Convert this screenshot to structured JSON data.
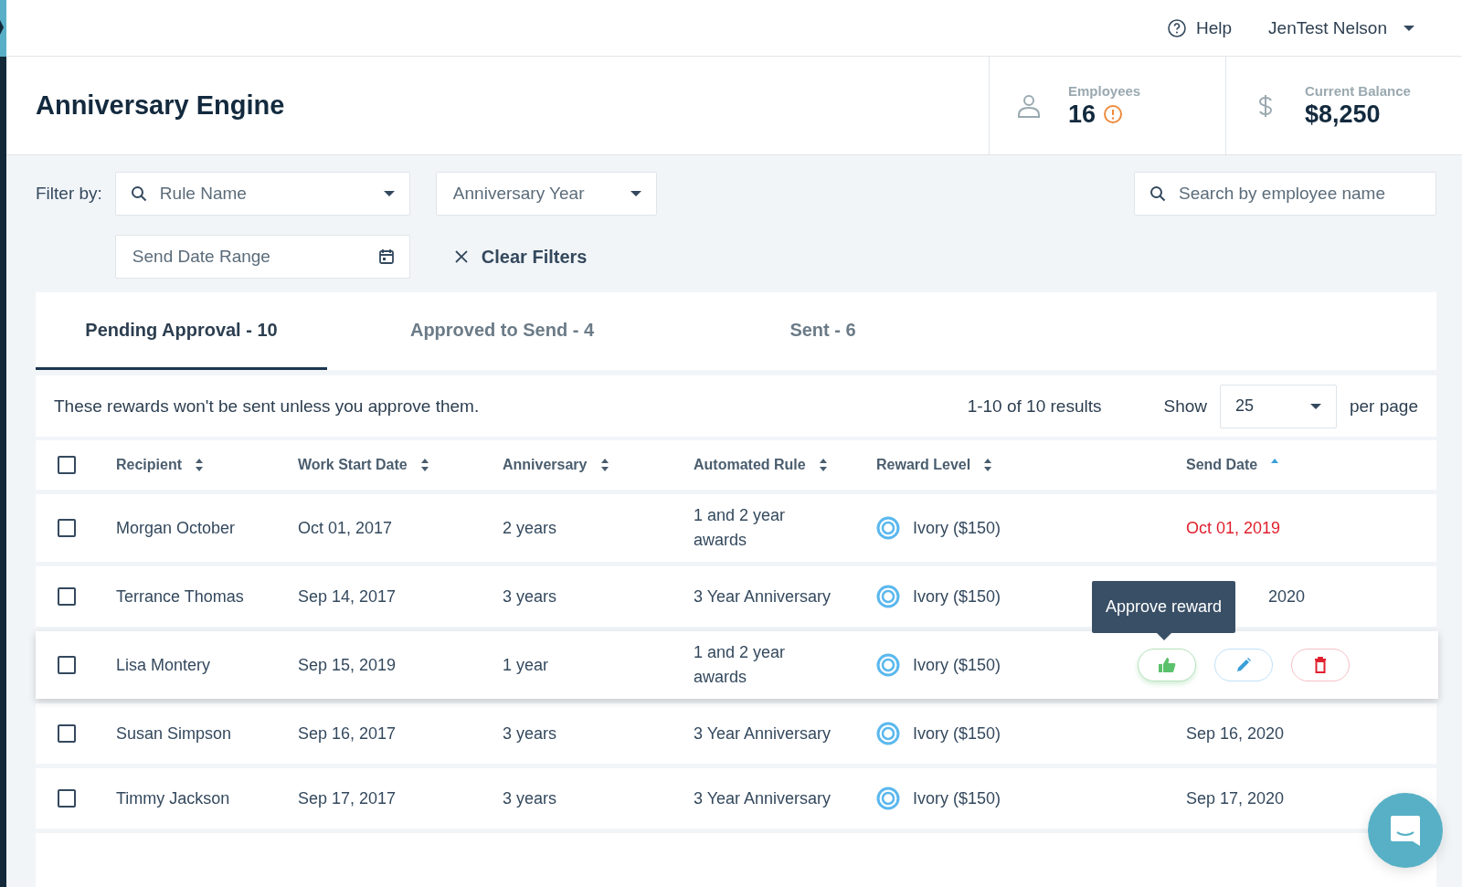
{
  "topbar": {
    "help": "Help",
    "user": "JenTest Nelson"
  },
  "header": {
    "title": "Anniversary Engine",
    "stats": [
      {
        "kind": "employees",
        "label": "Employees",
        "value": "16",
        "warning": true
      },
      {
        "kind": "balance",
        "label": "Current Balance",
        "value": "$8,250"
      }
    ]
  },
  "filters": {
    "label": "Filter by:",
    "rule_name": {
      "placeholder": "Rule Name"
    },
    "anniversary_year": {
      "placeholder": "Anniversary Year"
    },
    "send_date_range": {
      "placeholder": "Send Date Range"
    },
    "clear": "Clear Filters",
    "search": {
      "placeholder": "Search by employee name"
    }
  },
  "tabs": [
    {
      "label": "Pending Approval - 10",
      "selected": true
    },
    {
      "label": "Approved to Send - 4",
      "selected": false
    },
    {
      "label": "Sent - 6",
      "selected": false
    }
  ],
  "toolbar": {
    "note": "These rewards won't be sent unless you approve them.",
    "results": "1-10 of 10 results",
    "show": "Show",
    "page_size": "25",
    "per_page": "per page"
  },
  "table": {
    "select_all": {
      "checked": false
    },
    "columns": [
      {
        "label": "Recipient",
        "sorted": false
      },
      {
        "label": "Work Start Date",
        "sorted": false
      },
      {
        "label": "Anniversary",
        "sorted": false
      },
      {
        "label": "Automated Rule",
        "sorted": false
      },
      {
        "label": "Reward Level",
        "sorted": false
      },
      {
        "label": "Send Date",
        "sorted": true
      }
    ],
    "rows": [
      {
        "checked": false,
        "recipient": "Morgan October",
        "start": "Oct 01, 2017",
        "anniversary": "2 years",
        "rule": "1 and 2 year awards",
        "reward": "Ivory ($150)",
        "send_date": "Oct 01, 2019",
        "overdue": true,
        "hovered": false
      },
      {
        "checked": false,
        "recipient": "Terrance Thomas",
        "start": "Sep 14, 2017",
        "anniversary": "3 years",
        "rule": "3 Year Anniversary",
        "reward": "Ivory ($150)",
        "send_date": "2020",
        "overdue": false,
        "hovered": false
      },
      {
        "checked": false,
        "recipient": "Lisa Montery",
        "start": "Sep 15, 2019",
        "anniversary": "1 year",
        "rule": "1 and 2 year awards",
        "reward": "Ivory ($150)",
        "hovered": true,
        "tooltip": "Approve reward"
      },
      {
        "checked": false,
        "recipient": "Susan Simpson",
        "start": "Sep 16, 2017",
        "anniversary": "3 years",
        "rule": "3 Year Anniversary",
        "reward": "Ivory ($150)",
        "send_date": "Sep 16, 2020",
        "overdue": false,
        "hovered": false
      },
      {
        "checked": false,
        "recipient": "Timmy Jackson",
        "start": "Sep 17, 2017",
        "anniversary": "3 years",
        "rule": "3 Year Anniversary",
        "reward": "Ivory ($150)",
        "send_date": "Sep 17, 2020",
        "overdue": false,
        "hovered": false
      }
    ]
  }
}
